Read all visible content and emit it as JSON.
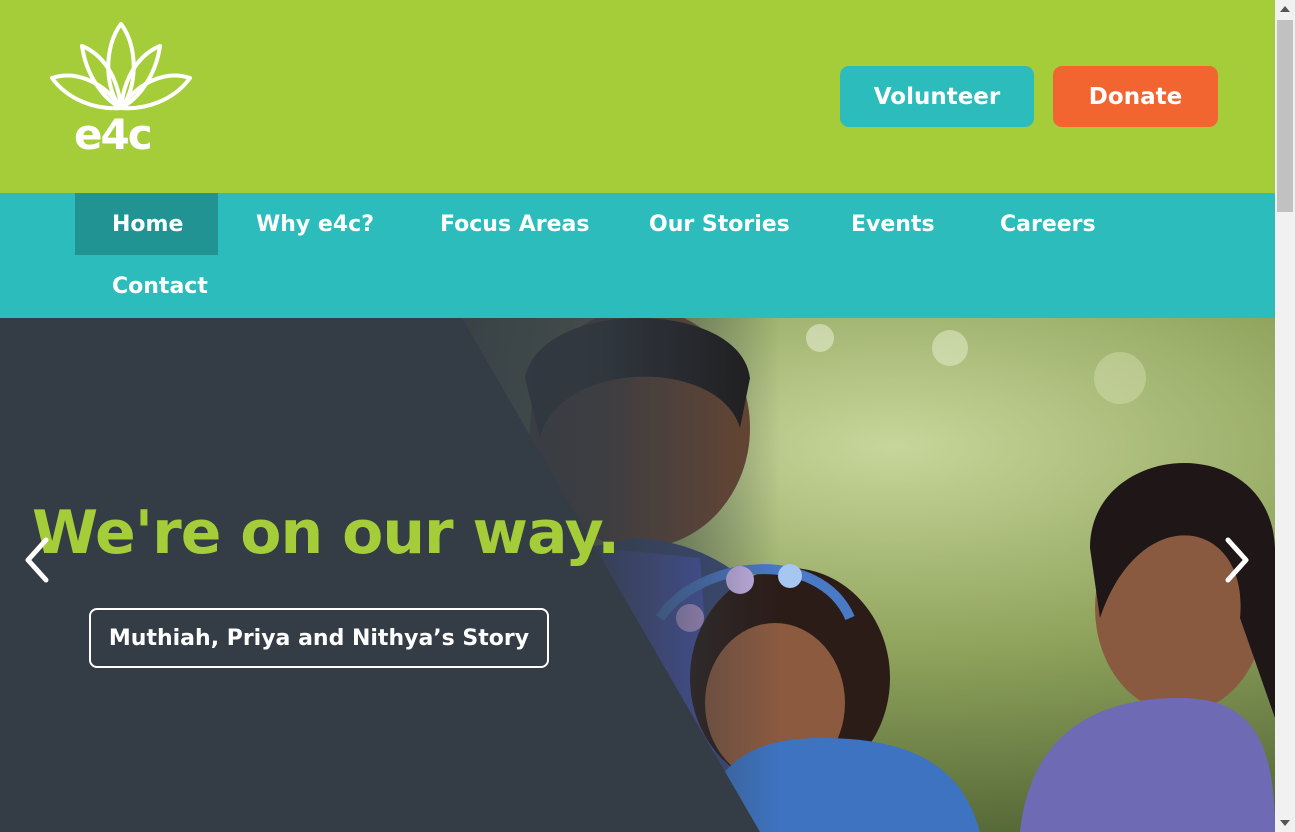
{
  "header": {
    "logo_text": "e4c",
    "volunteer_label": "Volunteer",
    "donate_label": "Donate",
    "colors": {
      "brand_green": "#a4cd39",
      "teal": "#2bbcbb",
      "orange": "#f26531"
    }
  },
  "nav": {
    "items": [
      {
        "label": "Home",
        "active": true
      },
      {
        "label": "Why e4c?"
      },
      {
        "label": "Focus Areas"
      },
      {
        "label": "Our Stories"
      },
      {
        "label": "Events"
      },
      {
        "label": "Careers"
      },
      {
        "label": "Contact"
      }
    ]
  },
  "hero": {
    "headline": "We're on our way.",
    "story_button": "Muthiah, Priya and Nithya’s Story",
    "icons": {
      "prev": "chevron-left-icon",
      "next": "chevron-right-icon"
    }
  }
}
